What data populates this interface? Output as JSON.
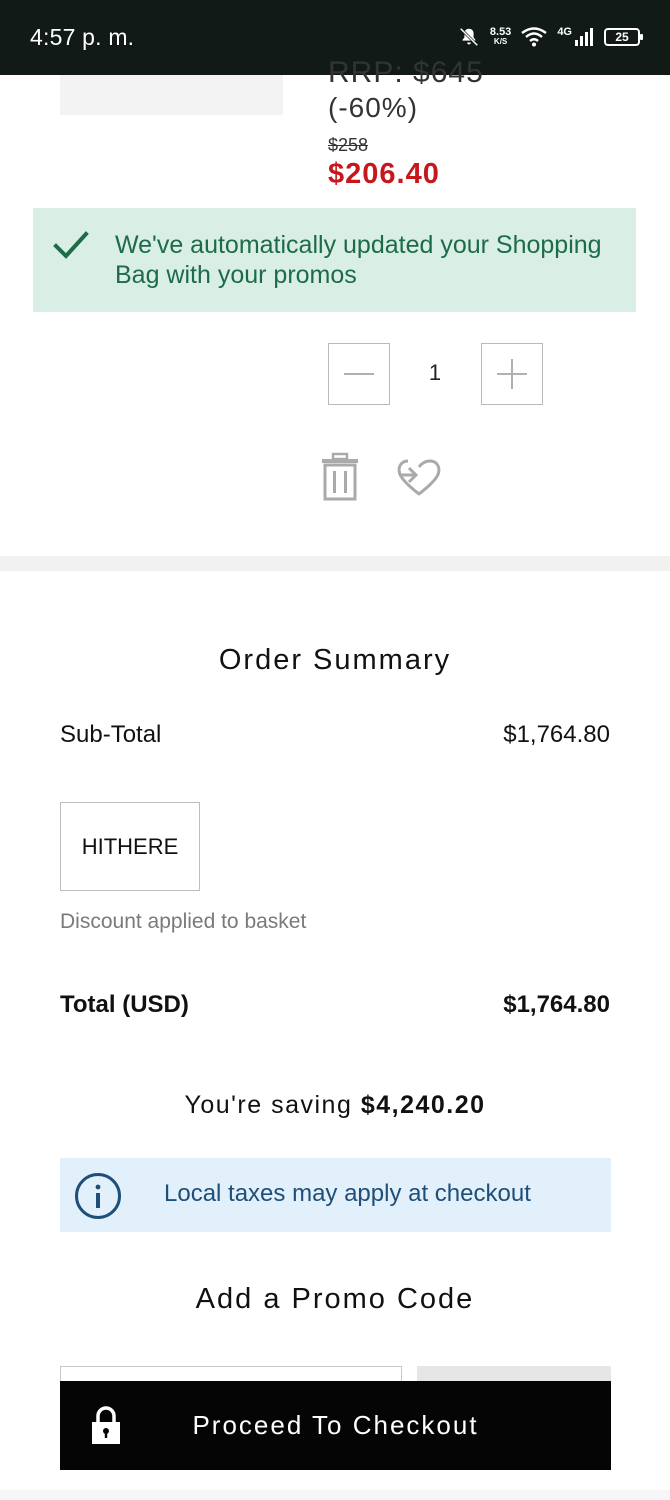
{
  "status_bar": {
    "time": "4:57 p. m.",
    "net_speed": "8.53",
    "net_unit": "K/S",
    "network": "4G",
    "battery": "25"
  },
  "product": {
    "rrp_line": "RRP: $645",
    "discount_pct": "(-60%)",
    "old_price": "$258",
    "new_price": "$206.40",
    "quantity": "1"
  },
  "toast": {
    "message": "We've automatically updated your Shopping Bag with your promos"
  },
  "summary": {
    "title": "Order Summary",
    "subtotal_label": "Sub-Total",
    "subtotal_value": "$1,764.80",
    "applied_code": "HITHERE",
    "discount_note": "Discount applied to basket",
    "total_label": "Total (USD)",
    "total_value": "$1,764.80",
    "saving_prefix": "You're saving",
    "saving_amount": "$4,240.20",
    "tax_notice": "Local taxes may apply at checkout"
  },
  "promo": {
    "title": "Add a Promo Code"
  },
  "checkout": {
    "label": "Proceed To Checkout"
  },
  "colors": {
    "status_bar": "#111a16",
    "sale_red": "#c8161d",
    "toast_bg": "#d9eee5",
    "toast_text": "#1d6b49",
    "info_bg": "#e1f0fb",
    "info_text": "#1f4e79",
    "checkout_bg": "#050505"
  },
  "icons": {
    "toast": "checkmark-icon",
    "trash": "trash-icon",
    "wishlist": "move-to-wishlist-heart-icon",
    "info": "info-icon",
    "lock": "lock-icon"
  }
}
